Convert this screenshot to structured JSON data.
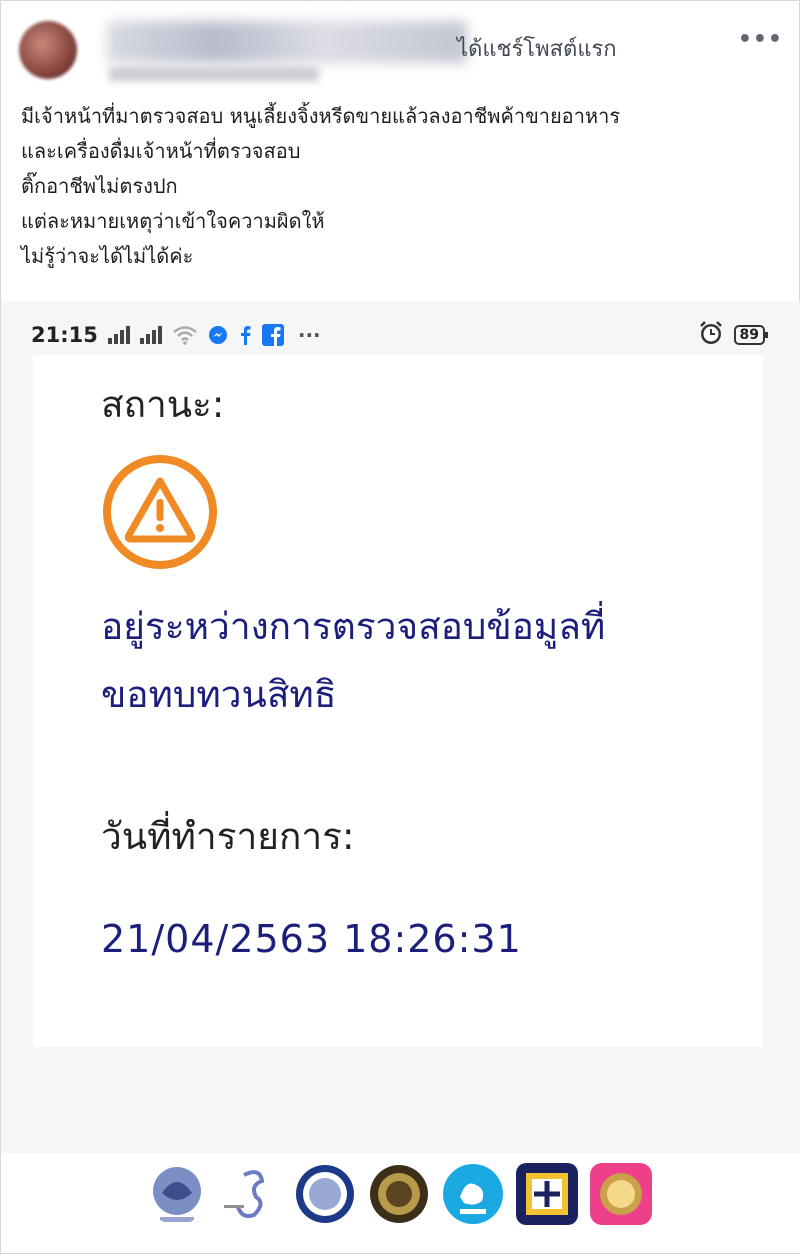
{
  "post": {
    "shared_text": "ได้แชร์โพสต์แรก",
    "lines": [
      "มีเจ้าหน้าที่มาตรวจสอบ หนูเลี้ยงจิ้งหรีดขายแล้วลงอาชีพค้าขายอาหาร",
      "และเครื่องดื่มเจ้าหน้าที่ตรวจสอบ",
      "ติ๊กอาชีพไม่ตรงปก",
      "แต่ละหมายเหตุว่าเข้าใจความผิดให้",
      "ไม่รู้ว่าจะได้ไม่ได้ค่ะ"
    ],
    "more_icon": "more-dots-icon"
  },
  "phone": {
    "time": "21:15",
    "battery": "89",
    "icons": [
      "signal-icon",
      "wifi-icon",
      "messenger-icon",
      "facebook-icon",
      "alarm-icon",
      "battery-icon"
    ]
  },
  "card": {
    "status_label": "สถานะ:",
    "status_value_line1": "อยู่ระหว่างการตรวจสอบข้อมูลที่",
    "status_value_line2": "ขอทบทวนสิทธิ",
    "date_label": "วันที่ทำรายการ:",
    "date_value": "21/04/2563 18:26:31",
    "warning_color": "#f08a24",
    "value_color": "#1c1e7c"
  },
  "logos": [
    "ministry-seal-logo",
    "social-security-logo",
    "bank-seal-logo",
    "government-seal-logo",
    "krungthai-logo",
    "ministry-badge-logo",
    "royal-emblem-logo"
  ]
}
